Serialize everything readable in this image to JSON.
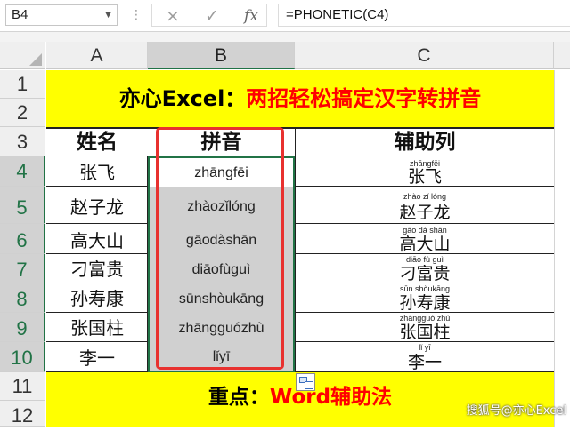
{
  "formula_bar": {
    "name_box": "B4",
    "formula": "=PHONETIC(C4)",
    "cancel_icon": "×",
    "enter_icon": "✓",
    "fx_icon": "fx"
  },
  "columns": [
    "A",
    "B",
    "C"
  ],
  "rows": [
    "1",
    "2",
    "3",
    "4",
    "5",
    "6",
    "7",
    "8",
    "9",
    "10",
    "11",
    "12"
  ],
  "title": {
    "black": "亦心Excel：",
    "red": "两招轻松搞定汉字转拼音"
  },
  "table": {
    "headers": [
      "姓名",
      "拼音",
      "辅助列"
    ],
    "rows": [
      {
        "name": "张飞",
        "pinyin": "zhāngfēi",
        "ruby": "zhāngfēi",
        "han": "张飞"
      },
      {
        "name": "赵子龙",
        "pinyin": "zhàozǐlóng",
        "ruby": "zhào  zǐ  lóng",
        "han": "赵子龙"
      },
      {
        "name": "高大山",
        "pinyin": "gāodàshān",
        "ruby": "gāo  dà  shān",
        "han": "高大山"
      },
      {
        "name": "刁富贵",
        "pinyin": "diāofùguì",
        "ruby": "diāo   fù   guì",
        "han": "刁富贵"
      },
      {
        "name": "孙寿康",
        "pinyin": "sūnshòukāng",
        "ruby": "sūn shòukāng",
        "han": "孙寿康"
      },
      {
        "name": "张国柱",
        "pinyin": "zhāngguózhù",
        "ruby": "zhāngguó zhù",
        "han": "张国柱"
      },
      {
        "name": "李一",
        "pinyin": "lǐyī",
        "ruby": "lǐ    yī",
        "han": "李一"
      }
    ]
  },
  "footer": {
    "black": "重点：",
    "red": "Word辅助法"
  },
  "watermark": "搜狐号@亦心Excel",
  "colors": {
    "yellow": "#ffff00",
    "red": "#ff0000",
    "highlight": "#e8312f",
    "selection": "#217346"
  }
}
